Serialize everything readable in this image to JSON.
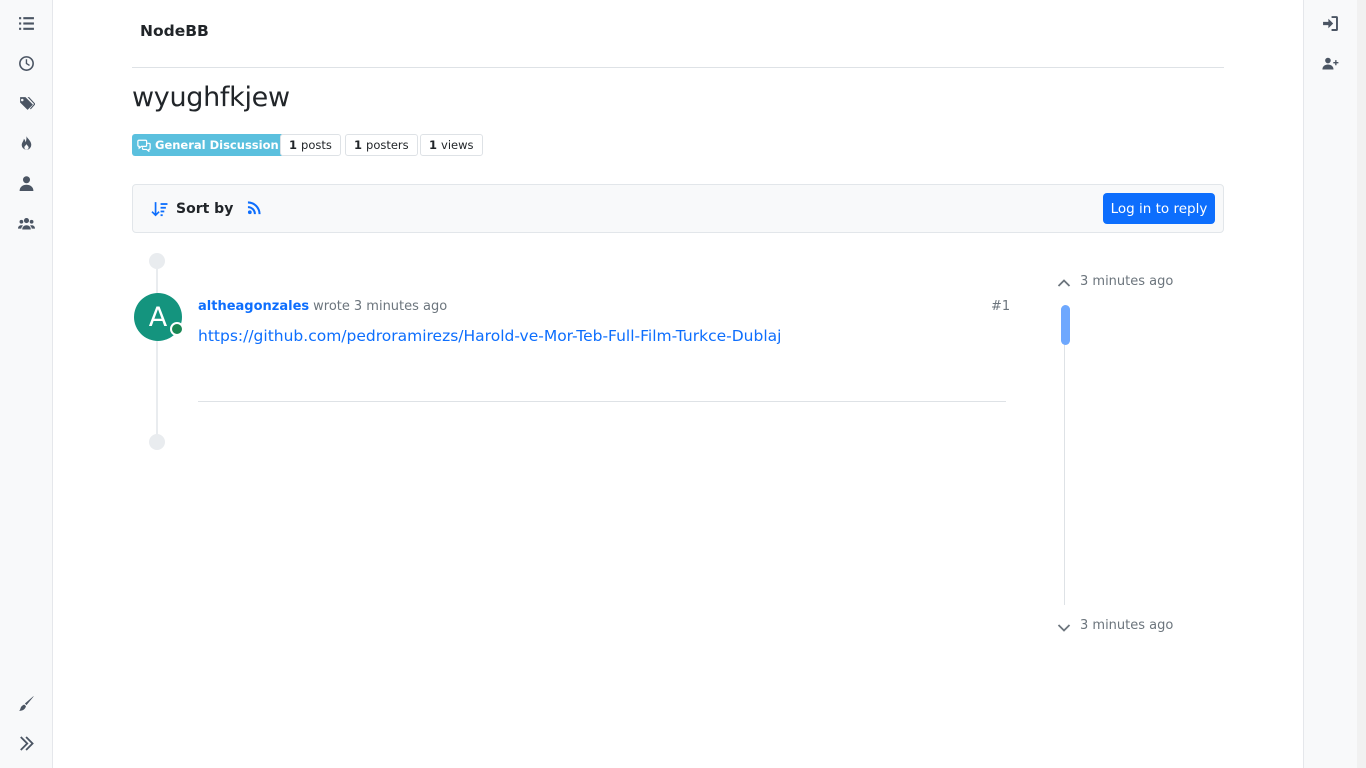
{
  "brand": {
    "name": "NodeBB"
  },
  "left_nav": {
    "items": [
      {
        "name": "categories",
        "icon": "list-icon"
      },
      {
        "name": "recent",
        "icon": "clock-icon"
      },
      {
        "name": "tags",
        "icon": "tags-icon"
      },
      {
        "name": "popular",
        "icon": "fire-icon"
      },
      {
        "name": "users",
        "icon": "user-icon"
      },
      {
        "name": "groups",
        "icon": "users-icon"
      }
    ],
    "bottom": [
      {
        "name": "skins",
        "icon": "paintbrush-icon"
      },
      {
        "name": "expand",
        "icon": "double-chevron-right-icon"
      }
    ]
  },
  "right_nav": {
    "items": [
      {
        "name": "login",
        "icon": "sign-in-icon"
      },
      {
        "name": "register",
        "icon": "user-plus-icon"
      }
    ]
  },
  "topic": {
    "title": "wyughfkjew",
    "category": "General Discussion",
    "category_color": "#5bc0de",
    "stats": {
      "posts_count": "1",
      "posts_label": "posts",
      "posters_count": "1",
      "posters_label": "posters",
      "views_count": "1",
      "views_label": "views"
    }
  },
  "toolbar": {
    "sort_label": "Sort by",
    "reply_label": "Log in to reply"
  },
  "post": {
    "author": "altheagonzales",
    "avatar_letter": "A",
    "avatar_color": "#14947e",
    "wrote": "wrote",
    "time": "3 minutes ago",
    "index": "#1",
    "content_link": "https://github.com/pedroramirezs/Harold-ve-Mor-Teb-Full-Film-Turkce-Dublaj"
  },
  "navigator": {
    "top_time": "3 minutes ago",
    "bottom_time": "3 minutes ago"
  }
}
